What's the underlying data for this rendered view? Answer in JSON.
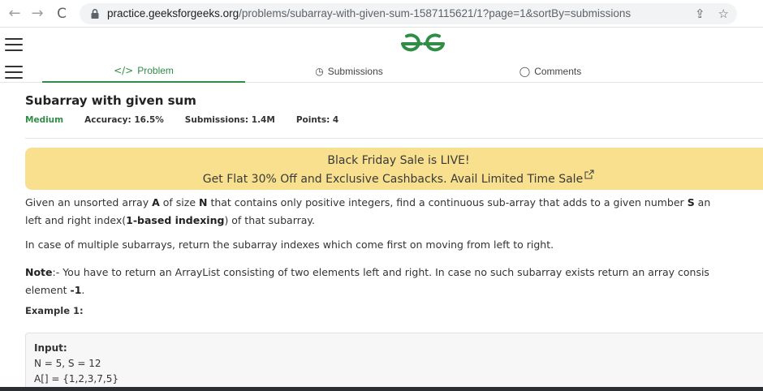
{
  "browser": {
    "url_host": "practice.geeksforgeeks.org",
    "url_path": "/problems/subarray-with-given-sum-1587115621/1?page=1&sortBy=submissions"
  },
  "tabs": [
    {
      "label": "Problem",
      "icon": "code-icon",
      "active": true
    },
    {
      "label": "Submissions",
      "icon": "clock-icon",
      "active": false
    },
    {
      "label": "Comments",
      "icon": "comment-icon",
      "active": false
    }
  ],
  "problem": {
    "title": "Subarray with given sum",
    "difficulty": "Medium",
    "accuracy": "Accuracy: 16.5%",
    "submissions": "Submissions: 1.4M",
    "points": "Points: 4"
  },
  "banner": {
    "line1": "Black Friday Sale is LIVE!",
    "line2": "Get Flat 30% Off and Exclusive Cashbacks. Avail Limited Time Sale"
  },
  "description": {
    "p1_a": "Given an unsorted array ",
    "p1_A": "A",
    "p1_b": " of size ",
    "p1_N": "N",
    "p1_c": " that contains only positive integers, find a continuous sub-array that adds to a given number ",
    "p1_S": "S",
    "p1_d": " an",
    "p1_line2_a": "left and right index(",
    "p1_line2_bold": "1-based indexing",
    "p1_line2_b": ") of that subarray.",
    "p2": "In case of multiple subarrays, return the subarray indexes which come first on moving from left to right.",
    "p3_note": "Note",
    "p3_a": ":- You have to return an ArrayList consisting of two elements left and right. In case no such subarray exists return an array consis",
    "p3_line2_a": "element ",
    "p3_line2_bold": "-1",
    "p3_line2_b": "."
  },
  "example": {
    "heading": "Example 1:",
    "input_label": "Input:",
    "line_ns": "N = 5, S = 12",
    "line_arr": "A[] = {1,2,3,7,5}"
  },
  "colors": {
    "accent": "#2f8d46",
    "banner": "#f8e08e"
  }
}
